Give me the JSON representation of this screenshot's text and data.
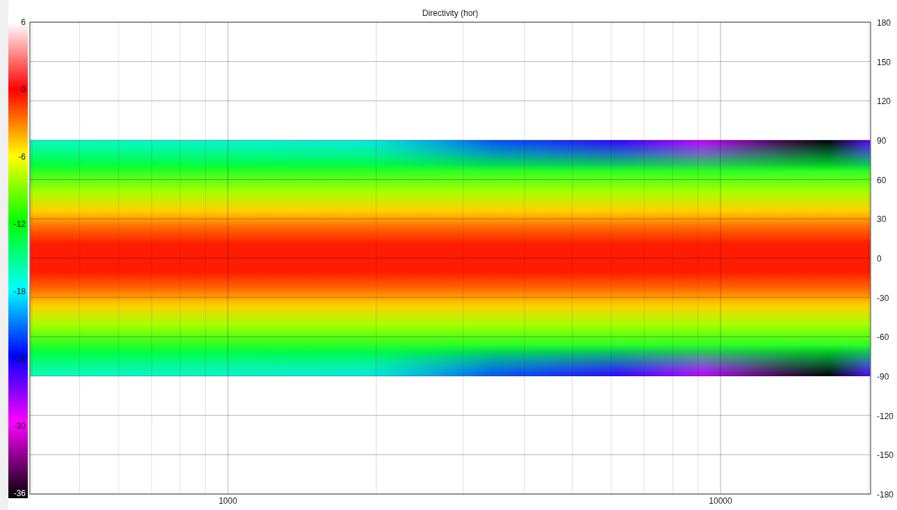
{
  "title": "Directivity (hor)",
  "color_scale": {
    "ticks": [
      "6",
      "0",
      "-6",
      "-12",
      "-18",
      "-24",
      "-30",
      "-36"
    ]
  },
  "y_axis": {
    "ticks": [
      "180",
      "150",
      "120",
      "90",
      "60",
      "30",
      "0",
      "-30",
      "-60",
      "-90",
      "-120",
      "-150",
      "-180"
    ]
  },
  "x_axis": {
    "ticks": [
      "1000",
      "10000"
    ]
  }
}
